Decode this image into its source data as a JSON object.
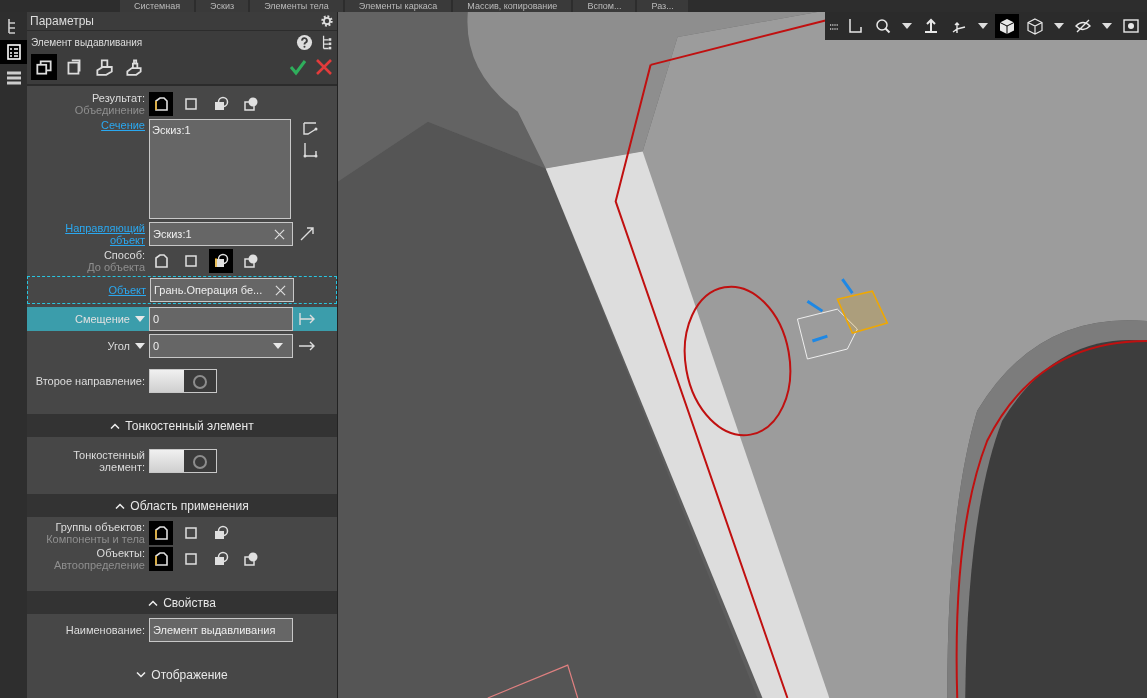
{
  "top_tabs": [
    "Системная",
    "Эскиз",
    "Элементы тела",
    "Элементы каркаса",
    "Массив, копирование",
    "Вспом...",
    "Раз..."
  ],
  "left_toolbar": [
    {
      "selected": false
    },
    {
      "selected": true
    },
    {
      "selected": false
    }
  ],
  "panel": {
    "title": "Параметры",
    "operation": "Элемент выдавливания",
    "mode_tabs": [
      {
        "selected": true
      },
      {
        "selected": false
      },
      {
        "selected": false
      },
      {
        "selected": false
      }
    ]
  },
  "rows": [
    {
      "kind": "options",
      "label": "Результат:",
      "value": "Объединение",
      "options": [
        {
          "selected": true
        },
        {
          "selected": false
        },
        {
          "selected": false
        },
        {
          "selected": false
        }
      ]
    },
    {
      "kind": "list",
      "label": "Сечение",
      "link": true,
      "items": [
        "Эскиз:1"
      ]
    },
    {
      "kind": "field",
      "label": "Направляющий объект",
      "link": true,
      "value": "Эскиз:1",
      "focused": false
    },
    {
      "kind": "options",
      "label": "Способ:",
      "value": "До объекта",
      "options": [
        {
          "selected": false
        },
        {
          "selected": false
        },
        {
          "selected": true
        },
        {
          "selected": false
        }
      ]
    },
    {
      "kind": "field",
      "label": "Объект",
      "link": true,
      "value": "Грань.Операция бе...",
      "focused": true
    },
    {
      "kind": "number",
      "label": "Смещение",
      "value": "0",
      "highlighted": true,
      "dropdown": false
    },
    {
      "kind": "number",
      "label": "Угол",
      "value": "0",
      "highlighted": false,
      "dropdown": true
    },
    {
      "kind": "toggle",
      "label": "Второе направление:",
      "on": false
    }
  ],
  "sections": [
    {
      "title": "Тонкостенный элемент",
      "expanded": true,
      "rows": [
        {
          "kind": "toggle",
          "label": "Тонкостенный элемент:",
          "on": false
        }
      ]
    },
    {
      "title": "Область применения",
      "expanded": true,
      "rows": [
        {
          "kind": "options",
          "label": "Группы объектов:",
          "value": "Компоненты и тела",
          "options": [
            {
              "selected": true
            },
            {
              "selected": false
            },
            {
              "selected": false
            }
          ]
        },
        {
          "kind": "options",
          "label": "Объекты:",
          "value": "Автоопределение",
          "options": [
            {
              "selected": true
            },
            {
              "selected": false
            },
            {
              "selected": false
            },
            {
              "selected": false
            }
          ]
        }
      ]
    },
    {
      "title": "Свойства",
      "expanded": true,
      "rows": [
        {
          "kind": "text",
          "label": "Наименование:",
          "value": "Элемент выдавливания"
        }
      ]
    },
    {
      "title": "Отображение",
      "expanded": false
    }
  ],
  "view_toolbar": [
    {
      "selected": false
    },
    {
      "selected": false
    },
    {
      "selected": false
    },
    {
      "selected": false
    },
    {
      "selected": true
    },
    {
      "selected": false
    },
    {
      "selected": false
    },
    {
      "selected": false
    }
  ]
}
